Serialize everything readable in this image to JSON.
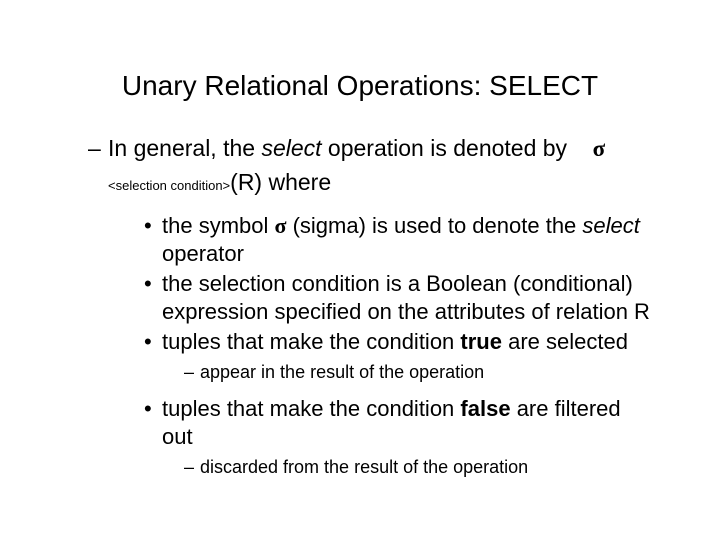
{
  "title": "Unary Relational Operations: SELECT",
  "intro": {
    "pre": "In general, the ",
    "sel": "select",
    "mid": " operation is denoted by",
    "sigmaGlyph": "σ",
    "sub": "<selection condition>",
    "afterSub": "(R) where"
  },
  "b1": {
    "pre": "the symbol ",
    "sigmaGlyph": "σ",
    "mid": " (sigma) is used to denote the ",
    "sel": "select",
    "post": " operator"
  },
  "b2": "the selection condition is a Boolean (conditional) expression specified on the attributes of relation R",
  "b3": {
    "pre": "tuples that make the condition ",
    "bold": "true",
    "post": " are selected"
  },
  "s3": "appear in the result of the operation",
  "b4": {
    "pre": "tuples that make the condition ",
    "bold": "false",
    "post": " are filtered out"
  },
  "s4": "discarded from the result of the operation"
}
